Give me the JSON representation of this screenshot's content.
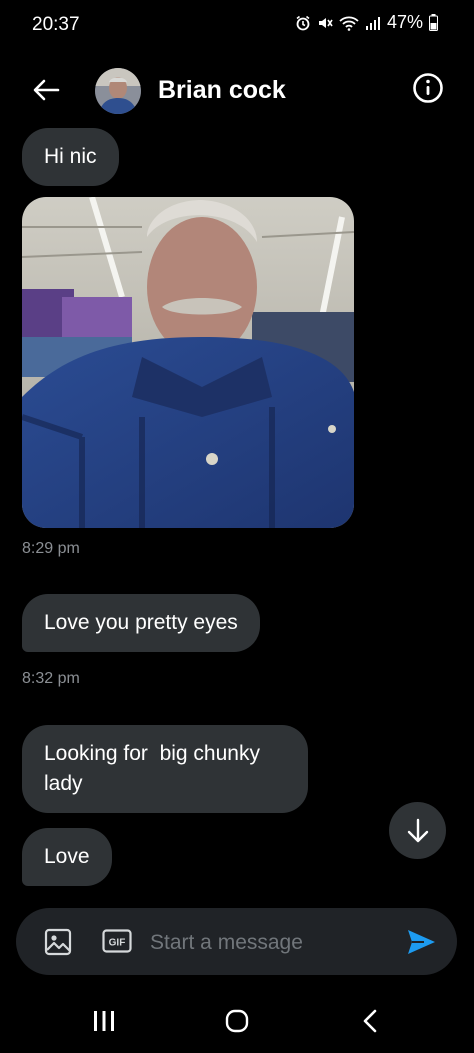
{
  "status_bar": {
    "time": "20:37",
    "battery": "47%",
    "icons": [
      "alarm-icon",
      "mute-icon",
      "wifi-icon",
      "signal-icon",
      "battery-icon"
    ]
  },
  "header": {
    "contact_name": "Brian cock",
    "icons": [
      "back-arrow-icon",
      "avatar",
      "info-icon"
    ]
  },
  "messages": [
    {
      "type": "text",
      "text": "Hi nic"
    },
    {
      "type": "image",
      "icon": "selfie-photo"
    },
    {
      "type": "timestamp",
      "text": "8:29 pm"
    },
    {
      "type": "text",
      "text": "Love you pretty eyes"
    },
    {
      "type": "timestamp",
      "text": "8:32 pm"
    },
    {
      "type": "text",
      "text": "Looking for  big chunky lady"
    },
    {
      "type": "text",
      "text": "Love"
    }
  ],
  "composer": {
    "placeholder": "Start a message",
    "gif_label": "GIF",
    "icons": [
      "image-icon",
      "gif-icon",
      "send-icon"
    ]
  },
  "colors": {
    "background": "#000000",
    "bubble": "#2f3336",
    "composer": "#202327",
    "accent": "#1d9bf0",
    "muted_text": "#8b8f94"
  },
  "nav_bar": {
    "icons": [
      "recents-icon",
      "home-icon",
      "back-icon"
    ]
  }
}
